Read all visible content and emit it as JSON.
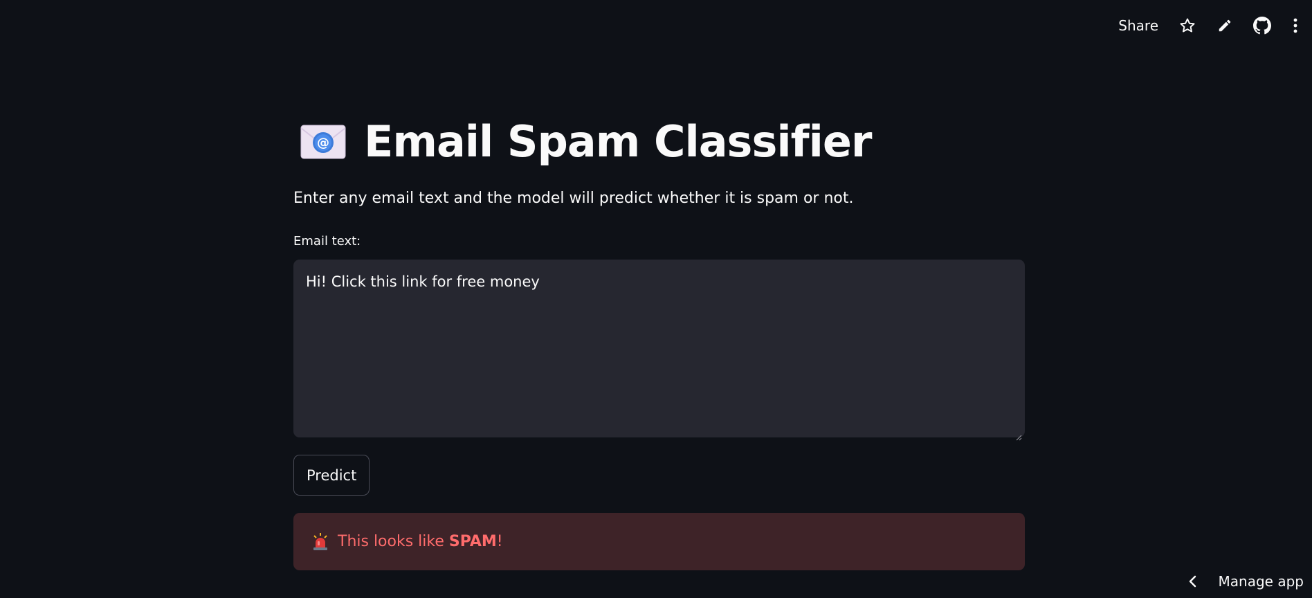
{
  "toolbar": {
    "share_label": "Share",
    "icons": [
      "star-icon",
      "pencil-icon",
      "github-icon",
      "more-vertical-icon"
    ]
  },
  "header": {
    "title": "Email Spam Classifier",
    "icon": "envelope-at-icon"
  },
  "main": {
    "subtitle": "Enter any email text and the model will predict whether it is spam or not.",
    "field_label": "Email text:",
    "email_value": "Hi! Click this link for free money",
    "predict_label": "Predict",
    "alert_prefix": "This looks like ",
    "alert_strong": "SPAM",
    "alert_suffix": "!",
    "alert_icon": "siren-icon"
  },
  "footer": {
    "manage_label": "Manage app"
  },
  "colors": {
    "background": "#0e1117",
    "textarea_bg": "#262730",
    "alert_bg": "#3e2328",
    "alert_text": "#ff6c6c"
  }
}
